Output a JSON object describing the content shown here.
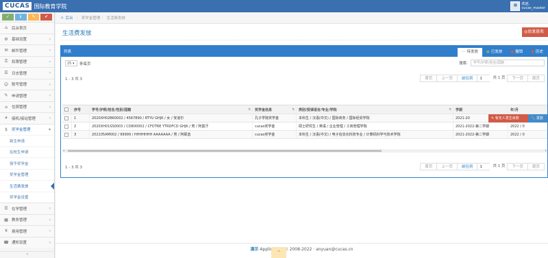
{
  "app": {
    "logo": "CUCAS",
    "title": "国际教育学院"
  },
  "user": {
    "greeting": "欢迎,",
    "name": "cucas_master"
  },
  "shortcuts": [
    "✓",
    "ℹ",
    "✎",
    "✔"
  ],
  "sidebar": {
    "items": [
      {
        "label": "后台首页",
        "icon": "⌂",
        "chev": false
      },
      {
        "label": "基础设置",
        "icon": "⚙",
        "chev": true
      },
      {
        "label": "邮件管理",
        "icon": "✉",
        "chev": true
      },
      {
        "label": "权限管理",
        "icon": "⚿",
        "chev": true
      },
      {
        "label": "日志管理",
        "icon": "☰",
        "chev": true
      },
      {
        "label": "账号管理",
        "icon": "☺",
        "chev": true
      },
      {
        "label": "申请管理",
        "icon": "✎",
        "chev": true
      },
      {
        "label": "住宿管理",
        "icon": "⌂",
        "chev": true
      },
      {
        "label": "接机/接站管理",
        "icon": "✈",
        "chev": true
      },
      {
        "label": "奖学金管理",
        "icon": "$",
        "chev": true,
        "active": true
      }
    ],
    "sub_items": [
      {
        "label": "新生申请"
      },
      {
        "label": "在校生申请"
      },
      {
        "label": "授予奖学金"
      },
      {
        "label": "奖学金管理"
      },
      {
        "label": "生活费发放",
        "current": true
      },
      {
        "label": "奖学金设置"
      }
    ],
    "bottom_items": [
      {
        "label": "在学管理",
        "icon": "☰",
        "chev": true
      },
      {
        "label": "教务管理",
        "icon": "▦",
        "chev": true
      },
      {
        "label": "费用管理",
        "icon": "¥",
        "chev": true
      },
      {
        "label": "通知设置",
        "icon": "☎",
        "chev": true
      }
    ],
    "collapse_icon": "«"
  },
  "breadcrumb": {
    "home_icon": "⌂",
    "home": "后台",
    "section": "奖学金管理",
    "current": "生活费发放"
  },
  "page": {
    "title": "生活费发放",
    "top_action": "◎尚发放名"
  },
  "panel": {
    "title": "列表",
    "tabs": [
      {
        "label": "待发放",
        "icon": "⋯",
        "color": "#555555",
        "active": true
      },
      {
        "label": "已发放",
        "icon": "●",
        "color": "#82af6f"
      },
      {
        "label": "撤销",
        "icon": "●",
        "color": "#d15b47"
      },
      {
        "label": "历史",
        "icon": "●",
        "color": "#d15b47"
      }
    ],
    "length_value": "25",
    "length_label": "条每页",
    "search_label": "搜索:",
    "search_placeholder": "学号/护照/姓名/国籍",
    "info": "1 - 3 共 3",
    "pager": {
      "first": "首页",
      "prev": "上一页",
      "jump": "前往到",
      "page": "1",
      "of": "共 1 页",
      "next": "下一页",
      "last": "尾页"
    },
    "columns": [
      "",
      "序号",
      "学号/护照/姓名/性别/国籍",
      "奖学金信息",
      "类别/授课语言/专业/学院",
      "学期",
      "年/月"
    ],
    "rows": [
      {
        "no": "1",
        "student": "2020XH02BK0002 / 4567890 / RTYU GHJK / 女 / 安道尔",
        "scholarship": "孔子学院奖学金",
        "program": "本科生 / 汉语(中文) / 国际商务 / 国际经贸学院",
        "term": "2021-20",
        "ym": ""
      },
      {
        "no": "2",
        "student": "2020XH01SS0003 / CD800002 / CFDTRE YTRDFCD GHJK / 男 / 阿富汗",
        "scholarship": "cucas奖学金",
        "program": "硕士研究生 / 英语 / 企业管理 / 工商管理学院",
        "term": "2021-2022-第二学期",
        "ym": "2022 / 0"
      },
      {
        "no": "3",
        "student": "202105AM002 / 99999 / HHHHHHH AAAAAAA / 男 / 阿联酋",
        "scholarship": "cucas奖学金",
        "program": "本科生 / 汉语(中文) / 电子信息化科技专业 / 计算机科学与技术学院",
        "term": "2021-2022-第二学期",
        "ym": "2022 / 0"
      }
    ],
    "row_actions": {
      "red": "✎ 有无人发生余款",
      "blue": "🔧 发放"
    }
  },
  "footer": {
    "brand": "演示",
    "text": "Application © 2008-2022 · anyuan@cucas.cn"
  },
  "scroll_top_icon": "⌃"
}
